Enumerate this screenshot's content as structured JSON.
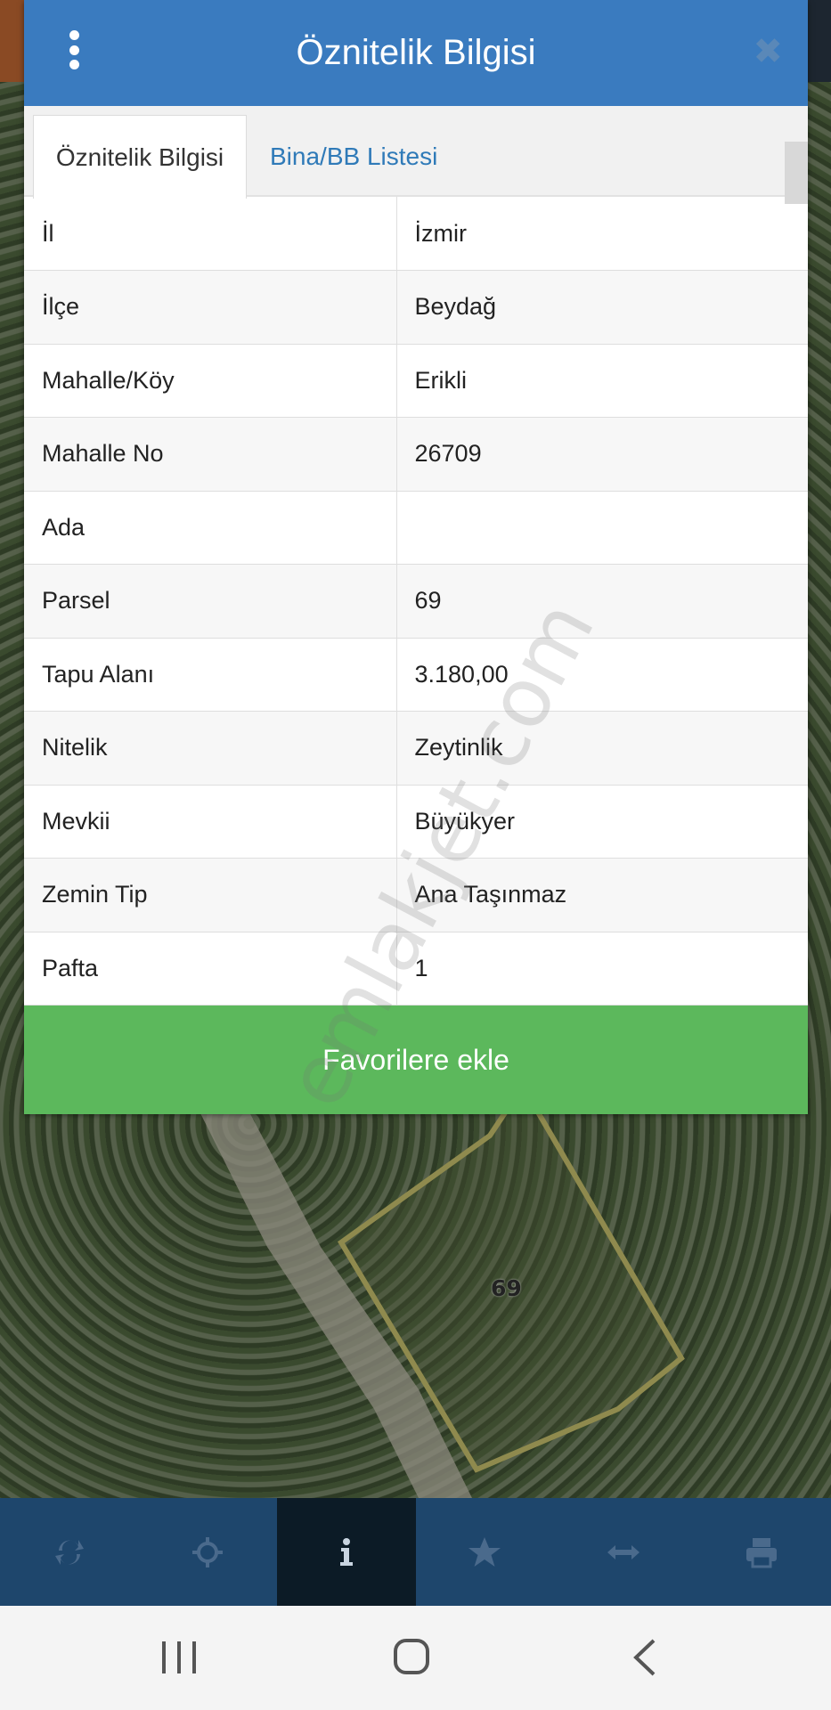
{
  "modal": {
    "title": "Öznitelik Bilgisi",
    "tabs": [
      {
        "label": "Öznitelik Bilgisi",
        "active": true
      },
      {
        "label": "Bina/BB Listesi",
        "active": false
      }
    ],
    "rows": [
      {
        "key": "İl",
        "value": "İzmir"
      },
      {
        "key": "İlçe",
        "value": "Beydağ"
      },
      {
        "key": "Mahalle/Köy",
        "value": "Erikli"
      },
      {
        "key": "Mahalle No",
        "value": "26709"
      },
      {
        "key": "Ada",
        "value": ""
      },
      {
        "key": "Parsel",
        "value": "69"
      },
      {
        "key": "Tapu Alanı",
        "value": "3.180,00"
      },
      {
        "key": "Nitelik",
        "value": "Zeytinlik"
      },
      {
        "key": "Mevkii",
        "value": "Büyükyer"
      },
      {
        "key": "Zemin Tip",
        "value": "Ana Taşınmaz"
      },
      {
        "key": "Pafta",
        "value": "1"
      }
    ],
    "favorite_button": "Favorilere ekle"
  },
  "map": {
    "parcel_label": "69",
    "parcel_color": "#8f8a4e"
  },
  "watermark": "emlakjet.com",
  "toolbar": {
    "items": [
      {
        "icon": "refresh-icon",
        "active": false
      },
      {
        "icon": "crosshair-icon",
        "active": false
      },
      {
        "icon": "info-icon",
        "active": true
      },
      {
        "icon": "star-icon",
        "active": false
      },
      {
        "icon": "measure-arrows-icon",
        "active": false
      },
      {
        "icon": "print-icon",
        "active": false
      }
    ],
    "background": "#1e466c",
    "active_background": "#0c1b26"
  },
  "colors": {
    "header": "#3a7bbf",
    "tab_link": "#2f7ab8",
    "favorite_button": "#5cb85c"
  }
}
